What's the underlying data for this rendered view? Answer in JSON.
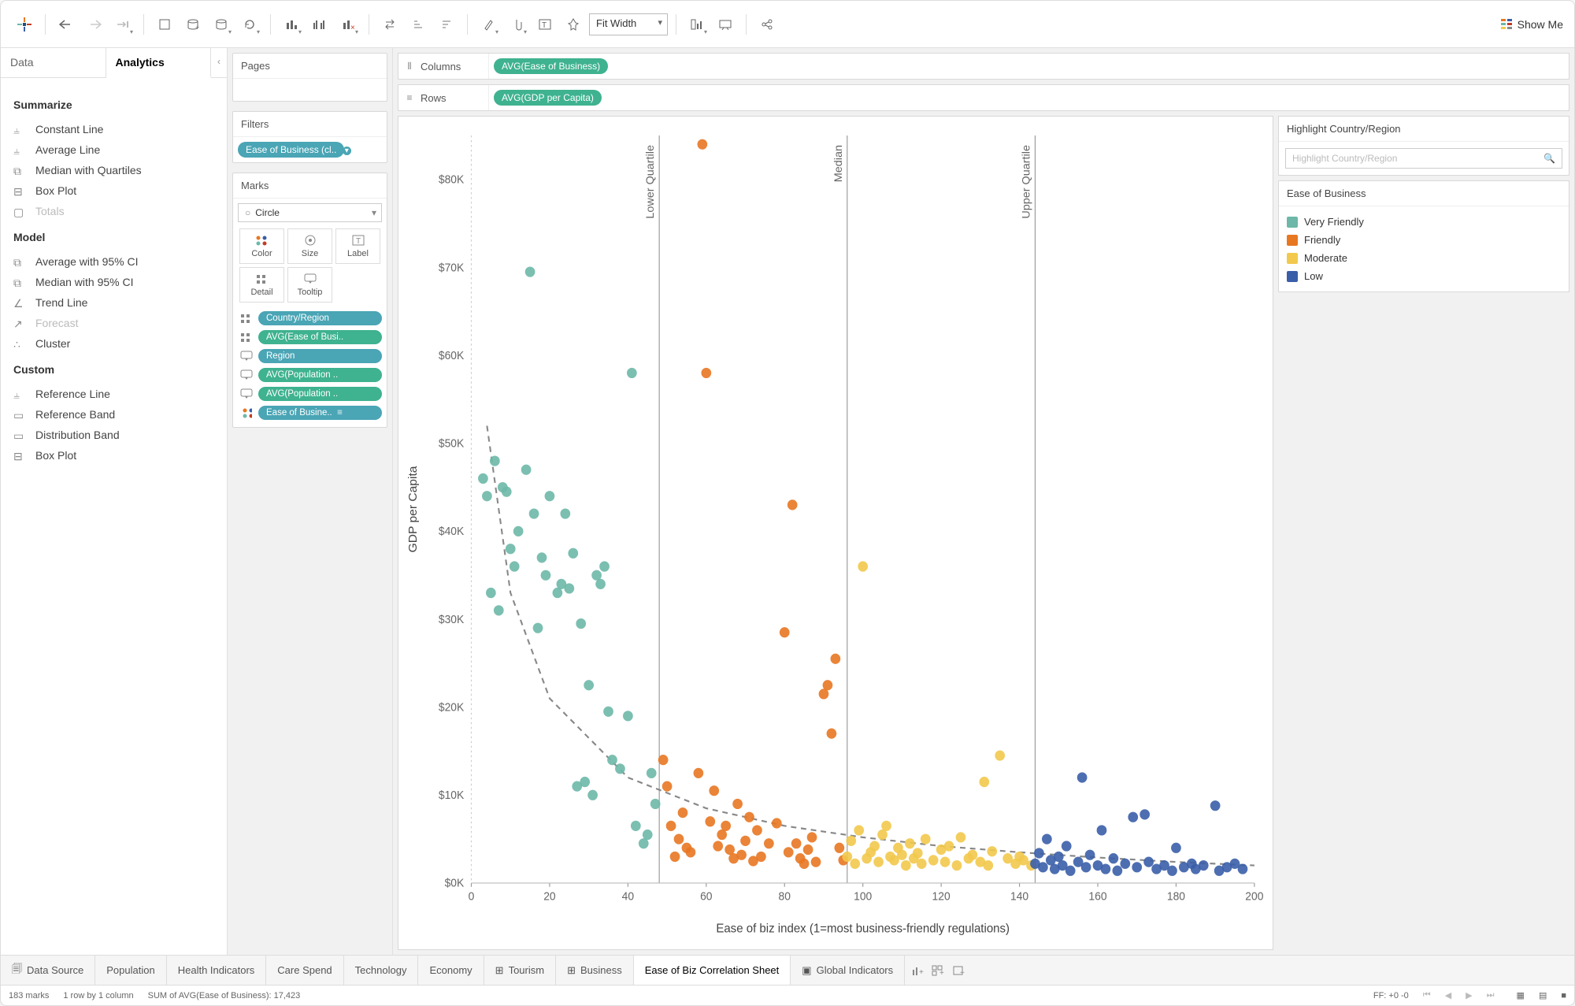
{
  "toolbar": {
    "fit_mode": "Fit Width",
    "show_me": "Show Me"
  },
  "left_tabs": {
    "data": "Data",
    "analytics": "Analytics"
  },
  "analytics": {
    "summarize_h": "Summarize",
    "summarize": [
      "Constant Line",
      "Average Line",
      "Median with Quartiles",
      "Box Plot",
      "Totals"
    ],
    "model_h": "Model",
    "model": [
      "Average with 95% CI",
      "Median with 95% CI",
      "Trend Line",
      "Forecast",
      "Cluster"
    ],
    "custom_h": "Custom",
    "custom": [
      "Reference Line",
      "Reference Band",
      "Distribution Band",
      "Box Plot"
    ]
  },
  "pages": {
    "title": "Pages"
  },
  "filters": {
    "title": "Filters",
    "pill": "Ease of Business (cl.."
  },
  "marks": {
    "title": "Marks",
    "mark_type": "Circle",
    "cells": [
      "Color",
      "Size",
      "Label",
      "Detail",
      "Tooltip"
    ],
    "pills": [
      {
        "label": "Country/Region",
        "cls": "blue",
        "icon": "detail"
      },
      {
        "label": "AVG(Ease of Busi..",
        "cls": "green",
        "icon": "detail"
      },
      {
        "label": "Region",
        "cls": "blue",
        "icon": "tooltip"
      },
      {
        "label": "AVG(Population ..",
        "cls": "green",
        "icon": "tooltip"
      },
      {
        "label": "AVG(Population ..",
        "cls": "green",
        "icon": "tooltip"
      },
      {
        "label": "Ease of Busine..",
        "cls": "blue",
        "icon": "color",
        "suffix": true
      }
    ]
  },
  "shelves": {
    "columns_label": "Columns",
    "columns_pill": "AVG(Ease of Business)",
    "rows_label": "Rows",
    "rows_pill": "AVG(GDP per Capita)"
  },
  "highlight": {
    "title": "Highlight Country/Region",
    "placeholder": "Highlight Country/Region"
  },
  "legend": {
    "title": "Ease of Business",
    "items": [
      {
        "label": "Very Friendly",
        "color": "#6db8a8"
      },
      {
        "label": "Friendly",
        "color": "#e87722"
      },
      {
        "label": "Moderate",
        "color": "#f2c94c"
      },
      {
        "label": "Low",
        "color": "#3a5ea8"
      }
    ]
  },
  "bottom_tabs": {
    "data_source": "Data Source",
    "tabs": [
      "Population",
      "Health Indicators",
      "Care Spend",
      "Technology",
      "Economy",
      "Tourism",
      "Business",
      "Ease of Biz Correlation Sheet",
      "Global Indicators"
    ],
    "active": "Ease of Biz Correlation Sheet"
  },
  "status": {
    "marks": "183 marks",
    "rowcol": "1 row by 1 column",
    "sum": "SUM of AVG(Ease of Business): 17,423",
    "ff": "FF: +0 -0"
  },
  "chart_data": {
    "type": "scatter",
    "xlabel": "Ease of biz index (1=most business-friendly regulations)",
    "ylabel": "GDP per Capita",
    "xlim": [
      0,
      200
    ],
    "ylim": [
      0,
      85000
    ],
    "x_ticks": [
      0,
      20,
      40,
      60,
      80,
      100,
      120,
      140,
      160,
      180,
      200
    ],
    "y_ticks": [
      0,
      10000,
      20000,
      30000,
      40000,
      50000,
      60000,
      70000,
      80000
    ],
    "y_tick_labels": [
      "$0K",
      "$10K",
      "$20K",
      "$30K",
      "$40K",
      "$50K",
      "$60K",
      "$70K",
      "$80K"
    ],
    "ref_lines": [
      {
        "label": "Lower Quartile",
        "x": 48
      },
      {
        "label": "Median",
        "x": 96
      },
      {
        "label": "Upper Quartile",
        "x": 144
      }
    ],
    "trend": {
      "kind": "power",
      "points": [
        [
          4,
          52000
        ],
        [
          10,
          33000
        ],
        [
          20,
          21000
        ],
        [
          40,
          12000
        ],
        [
          60,
          8500
        ],
        [
          80,
          6500
        ],
        [
          100,
          5200
        ],
        [
          120,
          4200
        ],
        [
          140,
          3500
        ],
        [
          160,
          2900
        ],
        [
          180,
          2400
        ],
        [
          200,
          2000
        ]
      ]
    },
    "series": [
      {
        "name": "Very Friendly",
        "color": "#6db8a8",
        "points": [
          [
            3,
            46000
          ],
          [
            4,
            44000
          ],
          [
            5,
            33000
          ],
          [
            6,
            48000
          ],
          [
            7,
            31000
          ],
          [
            8,
            45000
          ],
          [
            9,
            44500
          ],
          [
            10,
            38000
          ],
          [
            11,
            36000
          ],
          [
            12,
            40000
          ],
          [
            14,
            47000
          ],
          [
            15,
            69500
          ],
          [
            16,
            42000
          ],
          [
            17,
            29000
          ],
          [
            18,
            37000
          ],
          [
            19,
            35000
          ],
          [
            20,
            44000
          ],
          [
            22,
            33000
          ],
          [
            23,
            34000
          ],
          [
            24,
            42000
          ],
          [
            25,
            33500
          ],
          [
            26,
            37500
          ],
          [
            27,
            11000
          ],
          [
            28,
            29500
          ],
          [
            29,
            11500
          ],
          [
            30,
            22500
          ],
          [
            31,
            10000
          ],
          [
            32,
            35000
          ],
          [
            33,
            34000
          ],
          [
            34,
            36000
          ],
          [
            35,
            19500
          ],
          [
            36,
            14000
          ],
          [
            38,
            13000
          ],
          [
            40,
            19000
          ],
          [
            41,
            58000
          ],
          [
            42,
            6500
          ],
          [
            44,
            4500
          ],
          [
            45,
            5500
          ],
          [
            46,
            12500
          ],
          [
            47,
            9000
          ]
        ]
      },
      {
        "name": "Friendly",
        "color": "#e87722",
        "points": [
          [
            49,
            14000
          ],
          [
            50,
            11000
          ],
          [
            51,
            6500
          ],
          [
            52,
            3000
          ],
          [
            53,
            5000
          ],
          [
            54,
            8000
          ],
          [
            55,
            4000
          ],
          [
            56,
            3500
          ],
          [
            58,
            12500
          ],
          [
            59,
            84000
          ],
          [
            60,
            58000
          ],
          [
            61,
            7000
          ],
          [
            62,
            10500
          ],
          [
            63,
            4200
          ],
          [
            64,
            5500
          ],
          [
            65,
            6500
          ],
          [
            66,
            3800
          ],
          [
            67,
            2800
          ],
          [
            68,
            9000
          ],
          [
            69,
            3200
          ],
          [
            70,
            4800
          ],
          [
            71,
            7500
          ],
          [
            72,
            2500
          ],
          [
            73,
            6000
          ],
          [
            74,
            3000
          ],
          [
            76,
            4500
          ],
          [
            78,
            6800
          ],
          [
            80,
            28500
          ],
          [
            81,
            3500
          ],
          [
            82,
            43000
          ],
          [
            83,
            4500
          ],
          [
            84,
            2800
          ],
          [
            85,
            2200
          ],
          [
            86,
            3800
          ],
          [
            87,
            5200
          ],
          [
            88,
            2400
          ],
          [
            90,
            21500
          ],
          [
            91,
            22500
          ],
          [
            92,
            17000
          ],
          [
            93,
            25500
          ],
          [
            94,
            4000
          ],
          [
            95,
            2600
          ]
        ]
      },
      {
        "name": "Moderate",
        "color": "#f2c94c",
        "points": [
          [
            96,
            3000
          ],
          [
            97,
            4800
          ],
          [
            98,
            2200
          ],
          [
            99,
            6000
          ],
          [
            100,
            36000
          ],
          [
            101,
            2800
          ],
          [
            102,
            3500
          ],
          [
            103,
            4200
          ],
          [
            104,
            2400
          ],
          [
            105,
            5500
          ],
          [
            106,
            6500
          ],
          [
            107,
            3000
          ],
          [
            108,
            2600
          ],
          [
            109,
            4000
          ],
          [
            110,
            3200
          ],
          [
            111,
            2000
          ],
          [
            112,
            4500
          ],
          [
            113,
            2800
          ],
          [
            114,
            3400
          ],
          [
            115,
            2200
          ],
          [
            116,
            5000
          ],
          [
            118,
            2600
          ],
          [
            120,
            3800
          ],
          [
            121,
            2400
          ],
          [
            122,
            4200
          ],
          [
            124,
            2000
          ],
          [
            125,
            5200
          ],
          [
            127,
            2800
          ],
          [
            128,
            3200
          ],
          [
            130,
            2400
          ],
          [
            131,
            11500
          ],
          [
            132,
            2000
          ],
          [
            133,
            3600
          ],
          [
            135,
            14500
          ],
          [
            137,
            2800
          ],
          [
            139,
            2200
          ],
          [
            140,
            3000
          ],
          [
            141,
            2600
          ],
          [
            143,
            2000
          ]
        ]
      },
      {
        "name": "Low",
        "color": "#3a5ea8",
        "points": [
          [
            144,
            2200
          ],
          [
            145,
            3400
          ],
          [
            146,
            1800
          ],
          [
            147,
            5000
          ],
          [
            148,
            2600
          ],
          [
            149,
            1600
          ],
          [
            150,
            3000
          ],
          [
            151,
            2000
          ],
          [
            152,
            4200
          ],
          [
            153,
            1400
          ],
          [
            155,
            2400
          ],
          [
            156,
            12000
          ],
          [
            157,
            1800
          ],
          [
            158,
            3200
          ],
          [
            160,
            2000
          ],
          [
            161,
            6000
          ],
          [
            162,
            1600
          ],
          [
            164,
            2800
          ],
          [
            165,
            1400
          ],
          [
            167,
            2200
          ],
          [
            169,
            7500
          ],
          [
            170,
            1800
          ],
          [
            172,
            7800
          ],
          [
            173,
            2400
          ],
          [
            175,
            1600
          ],
          [
            177,
            2000
          ],
          [
            179,
            1400
          ],
          [
            180,
            4000
          ],
          [
            182,
            1800
          ],
          [
            184,
            2200
          ],
          [
            185,
            1600
          ],
          [
            187,
            2000
          ],
          [
            190,
            8800
          ],
          [
            191,
            1400
          ],
          [
            193,
            1800
          ],
          [
            195,
            2200
          ],
          [
            197,
            1600
          ]
        ]
      }
    ]
  }
}
